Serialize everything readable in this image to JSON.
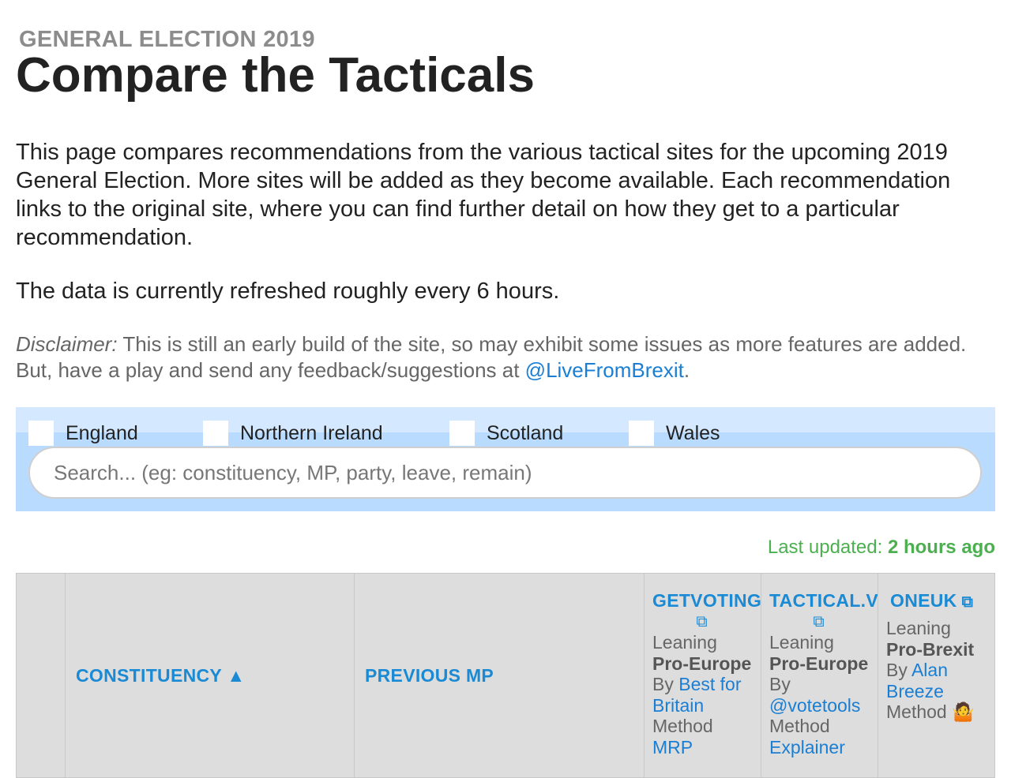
{
  "header": {
    "kicker": "GENERAL ELECTION 2019",
    "title": "Compare the Tacticals"
  },
  "intro": {
    "paragraph": "This page compares recommendations from the various tactical sites for the upcoming 2019 General Election. More sites will be added as they become available. Each recommendation links to the original site, where you can find further detail on how they get to a particular recommendation.",
    "refresh": "The data is currently refreshed roughly every 6 hours.",
    "disclaimer_label": "Disclaimer:",
    "disclaimer_text": " This is still an early build of the site, so may exhibit some issues as more features are added. But, have a play and send any feedback/suggestions at ",
    "disclaimer_link": "@LiveFromBrexit",
    "disclaimer_end": "."
  },
  "filters": {
    "regions": [
      "England",
      "Northern Ireland",
      "Scotland",
      "Wales"
    ],
    "search_placeholder": "Search... (eg: constituency, MP, party, leave, remain)"
  },
  "status": {
    "updated_label": "Last updated: ",
    "updated_value": "2 hours ago"
  },
  "table": {
    "columns": {
      "constituency": "CONSTITUENCY ▲",
      "previous_mp": "PREVIOUS MP"
    },
    "sites": [
      {
        "name": "GETVOTING",
        "leaning_label": "Leaning",
        "leaning": "Pro-Europe",
        "by_label": "By",
        "by": "Best for Britain",
        "method_label": "Method",
        "method": "MRP"
      },
      {
        "name": "TACTICAL.V",
        "leaning_label": "Leaning",
        "leaning": "Pro-Europe",
        "by_label": "By",
        "by": "@votetools",
        "method_label": "Method",
        "method": "Explainer"
      },
      {
        "name": "ONEUK",
        "leaning_label": "Leaning",
        "leaning": "Pro-Brexit",
        "by_label": "By",
        "by": "Alan Breeze",
        "method_label": "Method",
        "method": "🤷"
      }
    ],
    "external_icon": "external-link-icon"
  }
}
